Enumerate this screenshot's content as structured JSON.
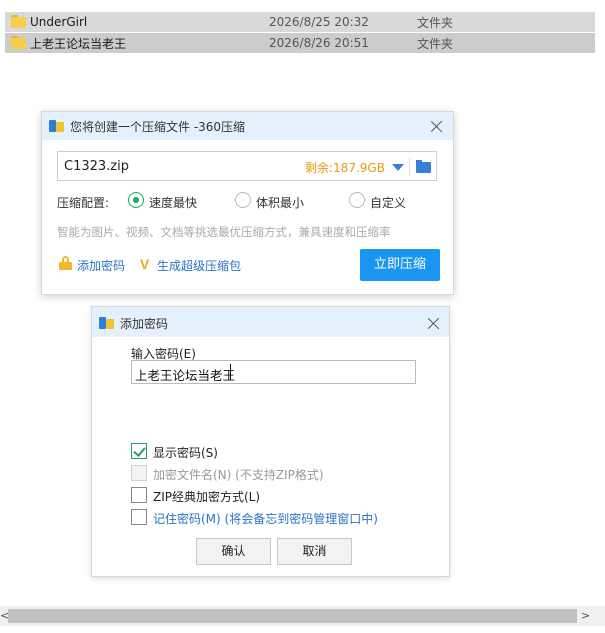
{
  "files": [
    {
      "name": "UnderGirl",
      "date": "2026/8/25 20:32",
      "type": "文件夹"
    },
    {
      "name": "上老王论坛当老王",
      "date": "2026/8/26 20:51",
      "type": "文件夹"
    }
  ],
  "compress_dialog": {
    "title": "您将创建一个压缩文件 -360压缩",
    "filename": "C1323.zip",
    "free_space": "剩余:187.9GB",
    "config_label": "压缩配置:",
    "options": [
      "速度最快",
      "体积最小",
      "自定义"
    ],
    "selected_option": "速度最快",
    "hint": "智能为图片、视频、文档等挑选最优压缩方式，兼具速度和压缩率",
    "add_password": "添加密码",
    "super_compress": "生成超级压缩包",
    "compress_button": "立即压缩",
    "accent_color": "#1a95f0"
  },
  "password_dialog": {
    "title": "添加密码",
    "input_label": "输入密码(E)",
    "password_value": "上老王论坛当老王",
    "options": [
      {
        "label": "显示密码(S)",
        "checked": true,
        "disabled": false
      },
      {
        "label": "加密文件名(N) (不支持ZIP格式)",
        "checked": false,
        "disabled": true
      },
      {
        "label": "ZIP经典加密方式(L)",
        "checked": false,
        "disabled": false
      },
      {
        "label": "记住密码(M) (将会备忘到密码管理窗口中)",
        "checked": false,
        "disabled": false
      }
    ],
    "ok_button": "确认",
    "cancel_button": "取消"
  },
  "scrollbar": {
    "left_arrow": "<",
    "right_arrow": ">"
  }
}
